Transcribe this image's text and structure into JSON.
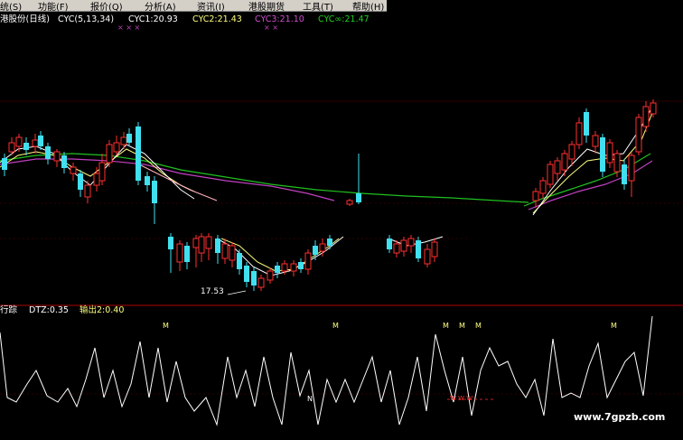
{
  "menu": {
    "items": [
      "统(S)",
      "功能(F)",
      "报价(Q)",
      "分析(A)",
      "资讯(I)",
      "港股期货",
      "工具(T)",
      "帮助(H)"
    ]
  },
  "main_panel": {
    "title": "港股份(日线)",
    "indicator": "CYC(5,13,34)",
    "cyc1": "CYC1:20.93",
    "cyc2": "CYC2:21.43",
    "cyc3": "CYC3:21.10",
    "cycinf": "CYC∞:21.47",
    "marks_top_left": "× × ×",
    "marks_top_right": "×  ×",
    "low_label": "17.53"
  },
  "sub_panel": {
    "title": "行踪",
    "dtz": "DTZ:0.35",
    "out": "输出2:0.40",
    "m_labels": [
      "M",
      "M",
      "M",
      "M",
      "M",
      "M"
    ],
    "n_label": "N",
    "w_labels": "W W W"
  },
  "watermark": "www.7gpzb.com",
  "colors": {
    "up": "#ff3030",
    "down": "#40e0f0",
    "ma_white": "#ffffff",
    "ma_yellow": "#ffff80",
    "ma_purple": "#c040c0",
    "ma_green": "#20c020",
    "divider": "#b00000",
    "dtz_line": "#ffffff"
  },
  "chart_data": {
    "type": "candlestick",
    "note": "",
    "candles_upper": [
      {
        "o": 183,
        "c": 177,
        "h": 172,
        "l": 188,
        "up": false
      },
      {
        "o": 168,
        "c": 160,
        "h": 155,
        "l": 172,
        "up": true
      },
      {
        "o": 163,
        "c": 155,
        "h": 150,
        "l": 168,
        "up": true
      },
      {
        "o": 155,
        "c": 160,
        "h": 150,
        "l": 166,
        "up": false
      },
      {
        "o": 165,
        "c": 158,
        "h": 152,
        "l": 172,
        "up": true
      },
      {
        "o": 150,
        "c": 162,
        "h": 145,
        "l": 166,
        "up": false
      },
      {
        "o": 162,
        "c": 172,
        "h": 158,
        "l": 178,
        "up": false
      },
      {
        "o": 168,
        "c": 178,
        "h": 165,
        "l": 183,
        "up": false
      },
      {
        "o": 173,
        "c": 186,
        "h": 170,
        "l": 190,
        "up": false
      },
      {
        "o": 186,
        "c": 193,
        "h": 182,
        "l": 200,
        "up": true
      },
      {
        "o": 193,
        "c": 210,
        "h": 188,
        "l": 220,
        "up": false
      },
      {
        "o": 208,
        "c": 218,
        "h": 202,
        "l": 225,
        "up": true
      },
      {
        "o": 205,
        "c": 195,
        "h": 185,
        "l": 212,
        "up": true
      },
      {
        "o": 200,
        "c": 182,
        "h": 170,
        "l": 205,
        "up": true
      },
      {
        "o": 182,
        "c": 160,
        "h": 155,
        "l": 186,
        "up": true
      },
      {
        "o": 162,
        "c": 168,
        "h": 150,
        "l": 172,
        "up": false
      },
      {
        "o": 168,
        "c": 156,
        "h": 148,
        "l": 172,
        "up": true
      },
      {
        "o": 150,
        "c": 160,
        "h": 145,
        "l": 163,
        "up": false
      },
      {
        "o": 140,
        "c": 205,
        "h": 135,
        "l": 210,
        "up": false
      },
      {
        "o": 198,
        "c": 205,
        "h": 190,
        "l": 215,
        "up": false
      },
      {
        "o": 203,
        "c": 222,
        "h": 198,
        "l": 248,
        "up": false
      }
    ]
  }
}
